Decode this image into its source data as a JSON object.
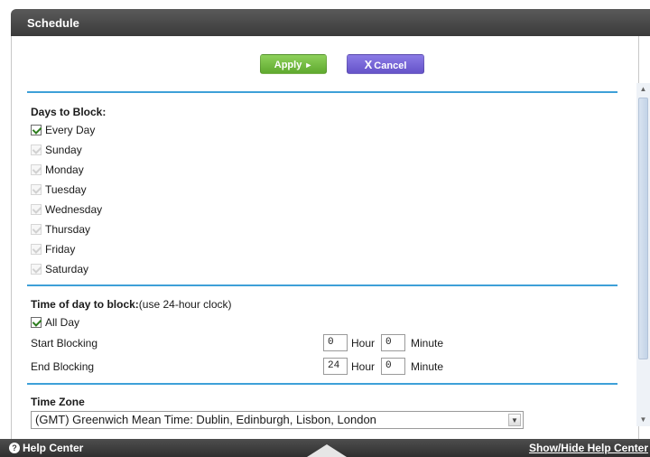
{
  "header": {
    "title": "Schedule"
  },
  "toolbar": {
    "apply_label": "Apply",
    "apply_arrow": "►",
    "cancel_x": "X",
    "cancel_label": "Cancel"
  },
  "days": {
    "title": "Days to Block:",
    "every_day": {
      "label": "Every Day",
      "checked": true
    },
    "items": [
      {
        "label": "Sunday",
        "checked": true,
        "disabled": true
      },
      {
        "label": "Monday",
        "checked": true,
        "disabled": true
      },
      {
        "label": "Tuesday",
        "checked": true,
        "disabled": true
      },
      {
        "label": "Wednesday",
        "checked": true,
        "disabled": true
      },
      {
        "label": "Thursday",
        "checked": true,
        "disabled": true
      },
      {
        "label": "Friday",
        "checked": true,
        "disabled": true
      },
      {
        "label": "Saturday",
        "checked": true,
        "disabled": true
      }
    ]
  },
  "time": {
    "title": "Time of day to block:",
    "subtitle": "(use 24-hour clock)",
    "all_day": {
      "label": "All Day",
      "checked": true
    },
    "start": {
      "label": "Start Blocking",
      "hour": "0",
      "minute": "0"
    },
    "end": {
      "label": "End Blocking",
      "hour": "24",
      "minute": "0"
    },
    "hour_unit": "Hour",
    "minute_unit": "Minute"
  },
  "timezone": {
    "title": "Time Zone",
    "selected": "(GMT) Greenwich Mean Time: Dublin, Edinburgh, Lisbon, London",
    "dropdown_glyph": "▼"
  },
  "scrollbar": {
    "up_glyph": "▲",
    "down_glyph": "▼"
  },
  "footer": {
    "help_icon_glyph": "?",
    "help_label": "Help Center",
    "show_hide_label": "Show/Hide Help Center"
  },
  "colors": {
    "apply": "#6fb83f",
    "cancel": "#7565d8",
    "divider": "#3ea0d8",
    "titlebar": "#484848"
  }
}
